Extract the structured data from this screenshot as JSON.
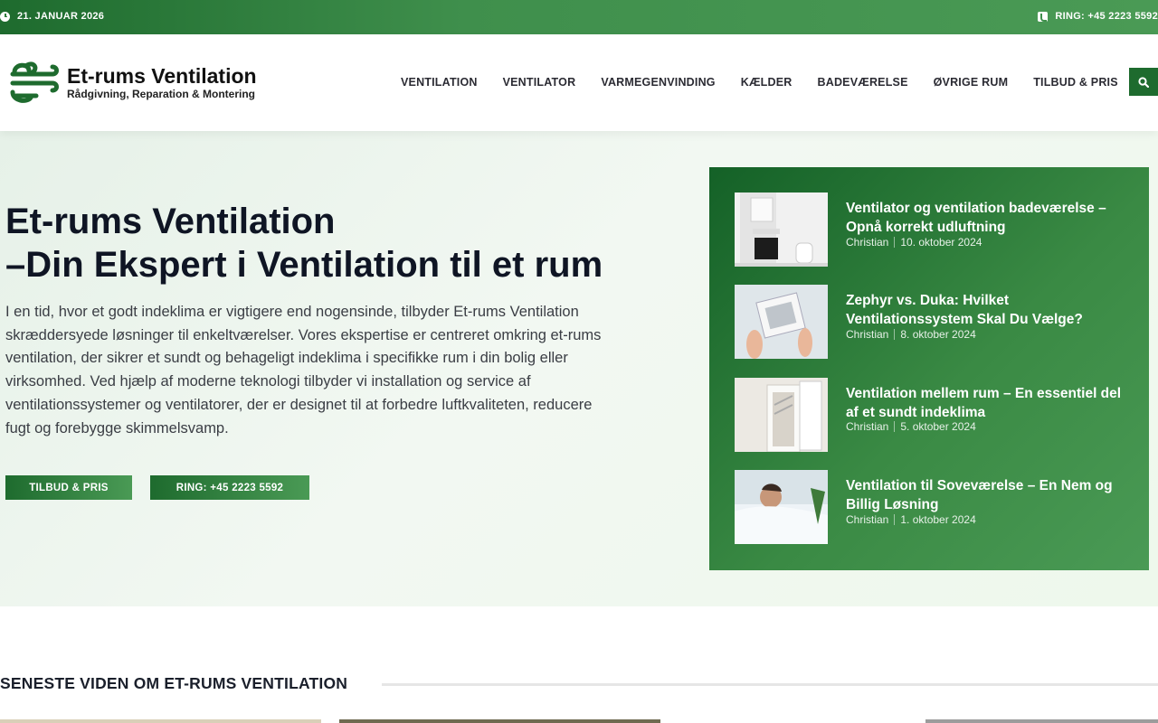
{
  "topbar": {
    "date": "21. JANUAR 2026",
    "phone": "RING: +45 2223 5592"
  },
  "header": {
    "logo_title": "Et-rums Ventilation",
    "logo_tagline": "Rådgivning, Reparation & Montering",
    "nav": [
      "VENTILATION",
      "VENTILATOR",
      "VARMEGENVINDING",
      "KÆLDER",
      "BADEVÆRELSE",
      "ØVRIGE RUM",
      "TILBUD & PRIS"
    ]
  },
  "hero": {
    "title_line1": "Et-rums Ventilation",
    "title_line2": "–Din Ekspert i Ventilation til et rum",
    "intro": "I en tid, hvor et godt indeklima er vigtigere end nogensinde, tilbyder Et-rums Ventilation skræddersyede løsninger til enkeltværelser. Vores ekspertise er centreret omkring et-rums ventilation, der sikrer et sundt og behageligt indeklima i specifikke rum i din bolig eller virksomhed. Ved hjælp af moderne teknologi tilbyder vi installation og service af ventilationssystemer og ventilatorer, der er designet til at forbedre luftkvaliteten, reducere fugt og forebygge skimmelsvamp.",
    "btn_offer": "TILBUD & PRIS",
    "btn_call": "RING: +45 2223 5592"
  },
  "posts": [
    {
      "title": "Ventilator og ventilation badeværelse – Opnå korrekt udluftning",
      "author": "Christian",
      "date": "10. oktober 2024"
    },
    {
      "title": "Zephyr vs. Duka: Hvilket Ventilationssystem Skal Du Vælge?",
      "author": "Christian",
      "date": "8. oktober 2024"
    },
    {
      "title": "Ventilation mellem rum – En essentiel del af et sundt indeklima",
      "author": "Christian",
      "date": "5. oktober 2024"
    },
    {
      "title": "Ventilation til Soveværelse – En Nem og Billig Løsning",
      "author": "Christian",
      "date": "1. oktober 2024"
    }
  ],
  "latest": {
    "heading": "SENESTE VIDEN OM ET-RUMS VENTILATION"
  },
  "colors": {
    "brand_dark": "#1e6b2e",
    "brand_light": "#4a9a55"
  }
}
